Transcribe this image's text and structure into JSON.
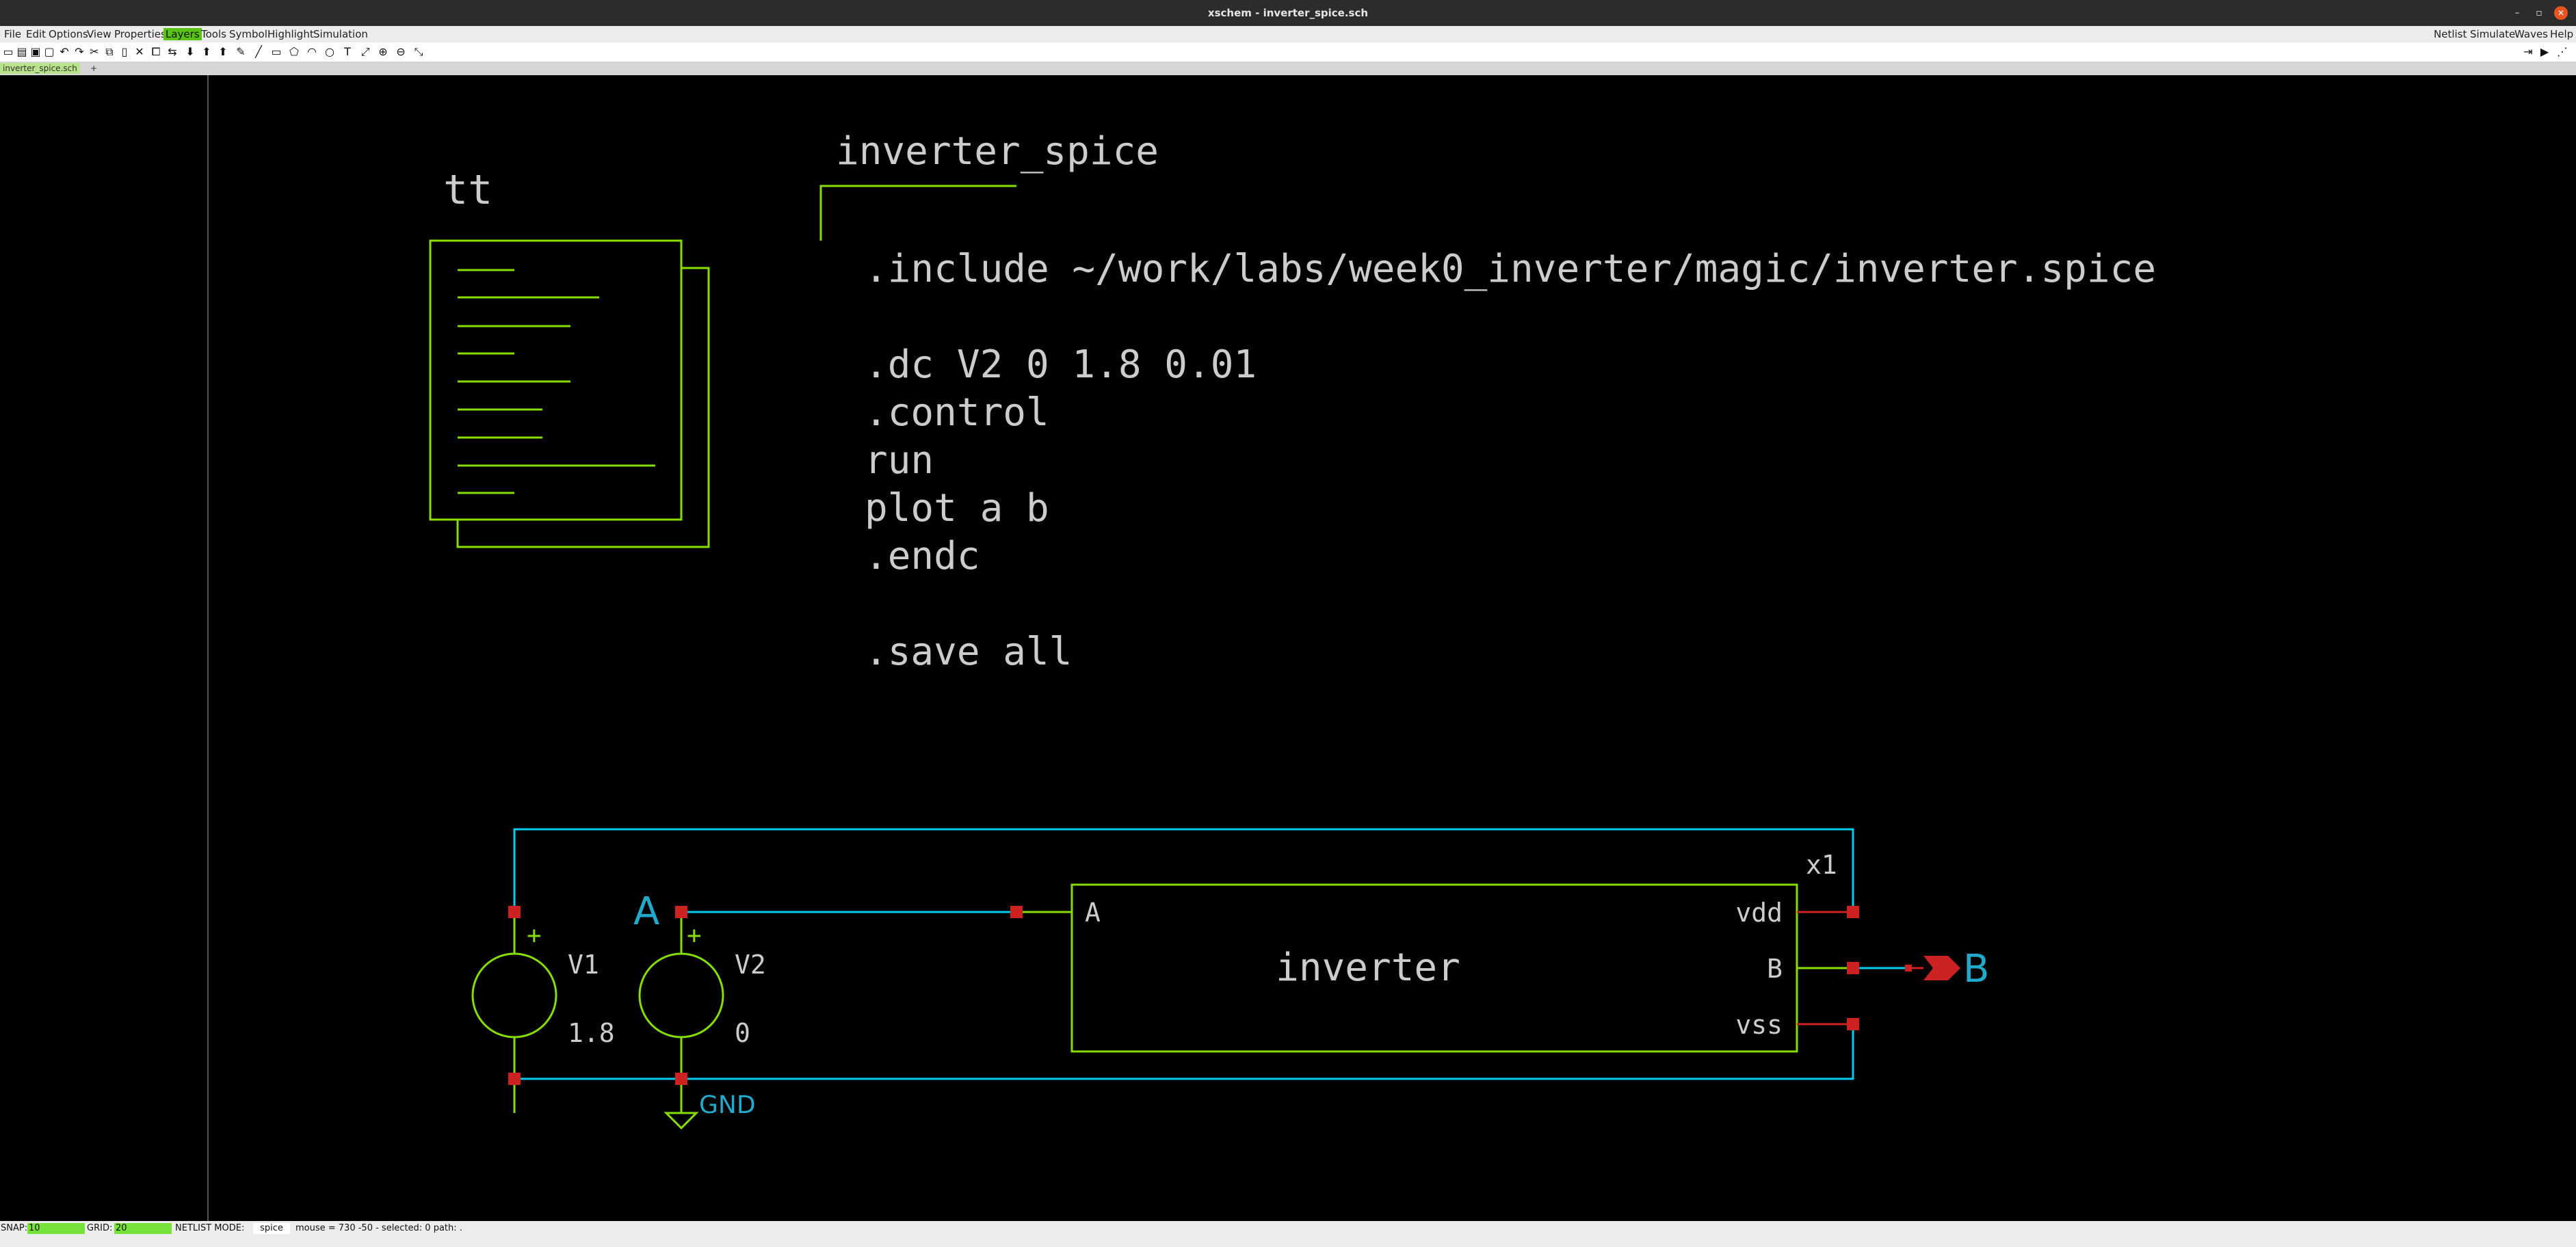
{
  "window": {
    "title": "xschem - inverter_spice.sch",
    "controls": [
      "–",
      "▫",
      "✕"
    ]
  },
  "menu": {
    "left": [
      "File",
      "Edit",
      "Options",
      "View",
      "Properties",
      "Layers",
      "Tools",
      "Symbol",
      "Highlight",
      "Simulation"
    ],
    "active": "Layers",
    "right": [
      "Netlist",
      "Simulate",
      "Waves",
      "Help"
    ]
  },
  "toolbar": {
    "icons": [
      "new-icon",
      "open-icon",
      "save-icon",
      "reload-icon",
      "undo-icon",
      "redo-icon",
      "cut-icon",
      "copy-icon",
      "paste-icon",
      "delete-icon",
      "duplicate-icon",
      "move-icon",
      "descend-icon",
      "ascend-icon",
      "push-icon",
      "wire-icon",
      "line-icon",
      "rect-icon",
      "polygon-icon",
      "arc-icon",
      "circle-icon",
      "text-icon",
      "zoom-full-icon",
      "zoom-in-icon",
      "zoom-out-icon",
      "zoom-box-icon"
    ],
    "right_icons": [
      "netlist-icon",
      "simulate-icon",
      "waves-icon"
    ]
  },
  "tabs": {
    "active": "inverter_spice.sch",
    "add_label": "+"
  },
  "schematic": {
    "corner_label": "tt",
    "code_title": "inverter_spice",
    "code_lines": [
      ".include ~/work/labs/week0_inverter/magic/inverter.spice",
      "",
      ".dc V2 0 1.8 0.01",
      ".control",
      "  run",
      "  plot a b",
      ".endc",
      "",
      ".save all"
    ],
    "instance_name": "x1",
    "block_name": "inverter",
    "block_pins": {
      "in": "A",
      "vdd": "vdd",
      "out": "B",
      "vss": "vss"
    },
    "sources": [
      {
        "name": "V1",
        "value": "1.8",
        "plus": "+"
      },
      {
        "name": "V2",
        "value": "0",
        "plus": "+"
      }
    ],
    "net_labels": {
      "input": "A",
      "output": "B",
      "ground": "GND"
    },
    "colors": {
      "wire": "#00ccee",
      "symbol": "#88dd00",
      "pin": "#cc2222",
      "text": "#cccccc",
      "net": "#22aacc"
    }
  },
  "status": {
    "snap_label": "SNAP:",
    "snap_value": "10",
    "grid_label": "GRID:",
    "grid_value": "20",
    "netlist_label": "NETLIST MODE:",
    "netlist_value": "spice",
    "info": "mouse = 730 -50 - selected: 0 path: ."
  }
}
